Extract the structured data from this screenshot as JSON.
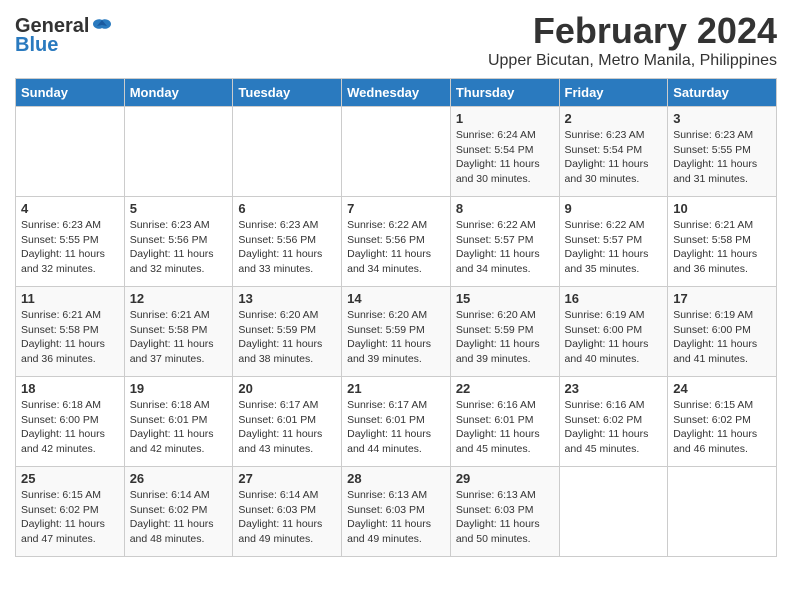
{
  "logo": {
    "general": "General",
    "blue": "Blue"
  },
  "title": {
    "month": "February 2024",
    "location": "Upper Bicutan, Metro Manila, Philippines"
  },
  "days_of_week": [
    "Sunday",
    "Monday",
    "Tuesday",
    "Wednesday",
    "Thursday",
    "Friday",
    "Saturday"
  ],
  "weeks": [
    [
      {
        "day": "",
        "info": ""
      },
      {
        "day": "",
        "info": ""
      },
      {
        "day": "",
        "info": ""
      },
      {
        "day": "",
        "info": ""
      },
      {
        "day": "1",
        "info": "Sunrise: 6:24 AM\nSunset: 5:54 PM\nDaylight: 11 hours and 30 minutes."
      },
      {
        "day": "2",
        "info": "Sunrise: 6:23 AM\nSunset: 5:54 PM\nDaylight: 11 hours and 30 minutes."
      },
      {
        "day": "3",
        "info": "Sunrise: 6:23 AM\nSunset: 5:55 PM\nDaylight: 11 hours and 31 minutes."
      }
    ],
    [
      {
        "day": "4",
        "info": "Sunrise: 6:23 AM\nSunset: 5:55 PM\nDaylight: 11 hours and 32 minutes."
      },
      {
        "day": "5",
        "info": "Sunrise: 6:23 AM\nSunset: 5:56 PM\nDaylight: 11 hours and 32 minutes."
      },
      {
        "day": "6",
        "info": "Sunrise: 6:23 AM\nSunset: 5:56 PM\nDaylight: 11 hours and 33 minutes."
      },
      {
        "day": "7",
        "info": "Sunrise: 6:22 AM\nSunset: 5:56 PM\nDaylight: 11 hours and 34 minutes."
      },
      {
        "day": "8",
        "info": "Sunrise: 6:22 AM\nSunset: 5:57 PM\nDaylight: 11 hours and 34 minutes."
      },
      {
        "day": "9",
        "info": "Sunrise: 6:22 AM\nSunset: 5:57 PM\nDaylight: 11 hours and 35 minutes."
      },
      {
        "day": "10",
        "info": "Sunrise: 6:21 AM\nSunset: 5:58 PM\nDaylight: 11 hours and 36 minutes."
      }
    ],
    [
      {
        "day": "11",
        "info": "Sunrise: 6:21 AM\nSunset: 5:58 PM\nDaylight: 11 hours and 36 minutes."
      },
      {
        "day": "12",
        "info": "Sunrise: 6:21 AM\nSunset: 5:58 PM\nDaylight: 11 hours and 37 minutes."
      },
      {
        "day": "13",
        "info": "Sunrise: 6:20 AM\nSunset: 5:59 PM\nDaylight: 11 hours and 38 minutes."
      },
      {
        "day": "14",
        "info": "Sunrise: 6:20 AM\nSunset: 5:59 PM\nDaylight: 11 hours and 39 minutes."
      },
      {
        "day": "15",
        "info": "Sunrise: 6:20 AM\nSunset: 5:59 PM\nDaylight: 11 hours and 39 minutes."
      },
      {
        "day": "16",
        "info": "Sunrise: 6:19 AM\nSunset: 6:00 PM\nDaylight: 11 hours and 40 minutes."
      },
      {
        "day": "17",
        "info": "Sunrise: 6:19 AM\nSunset: 6:00 PM\nDaylight: 11 hours and 41 minutes."
      }
    ],
    [
      {
        "day": "18",
        "info": "Sunrise: 6:18 AM\nSunset: 6:00 PM\nDaylight: 11 hours and 42 minutes."
      },
      {
        "day": "19",
        "info": "Sunrise: 6:18 AM\nSunset: 6:01 PM\nDaylight: 11 hours and 42 minutes."
      },
      {
        "day": "20",
        "info": "Sunrise: 6:17 AM\nSunset: 6:01 PM\nDaylight: 11 hours and 43 minutes."
      },
      {
        "day": "21",
        "info": "Sunrise: 6:17 AM\nSunset: 6:01 PM\nDaylight: 11 hours and 44 minutes."
      },
      {
        "day": "22",
        "info": "Sunrise: 6:16 AM\nSunset: 6:01 PM\nDaylight: 11 hours and 45 minutes."
      },
      {
        "day": "23",
        "info": "Sunrise: 6:16 AM\nSunset: 6:02 PM\nDaylight: 11 hours and 45 minutes."
      },
      {
        "day": "24",
        "info": "Sunrise: 6:15 AM\nSunset: 6:02 PM\nDaylight: 11 hours and 46 minutes."
      }
    ],
    [
      {
        "day": "25",
        "info": "Sunrise: 6:15 AM\nSunset: 6:02 PM\nDaylight: 11 hours and 47 minutes."
      },
      {
        "day": "26",
        "info": "Sunrise: 6:14 AM\nSunset: 6:02 PM\nDaylight: 11 hours and 48 minutes."
      },
      {
        "day": "27",
        "info": "Sunrise: 6:14 AM\nSunset: 6:03 PM\nDaylight: 11 hours and 49 minutes."
      },
      {
        "day": "28",
        "info": "Sunrise: 6:13 AM\nSunset: 6:03 PM\nDaylight: 11 hours and 49 minutes."
      },
      {
        "day": "29",
        "info": "Sunrise: 6:13 AM\nSunset: 6:03 PM\nDaylight: 11 hours and 50 minutes."
      },
      {
        "day": "",
        "info": ""
      },
      {
        "day": "",
        "info": ""
      }
    ]
  ]
}
